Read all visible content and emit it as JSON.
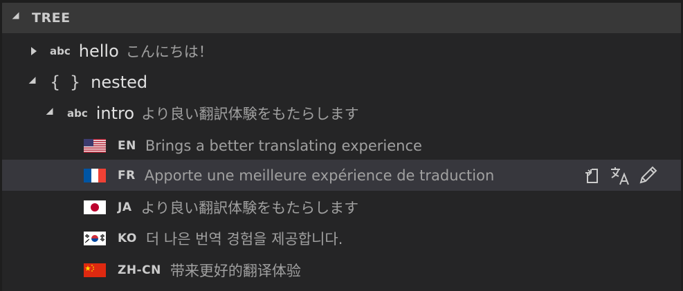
{
  "section": {
    "title": "TREE"
  },
  "rows": [
    {
      "kind": "abc",
      "key": "hello",
      "desc": "こんにちは！"
    },
    {
      "kind": "{ }",
      "key": "nested"
    },
    {
      "kind": "abc",
      "key": "intro",
      "desc": "より良い翻訳体験をもたらします"
    }
  ],
  "translations": [
    {
      "code": "EN",
      "flag": "us-flag-icon",
      "text": "Brings a better translating experience"
    },
    {
      "code": "FR",
      "flag": "france-flag-icon",
      "text": "Apporte une meilleure expérience de traduction"
    },
    {
      "code": "JA",
      "flag": "japan-flag-icon",
      "text": "より良い翻訳体験をもたらします"
    },
    {
      "code": "KO",
      "flag": "korea-flag-icon",
      "text": "더 나은 번역 경험을 제공합니다."
    },
    {
      "code": "ZH-CN",
      "flag": "china-flag-icon",
      "text": "带来更好的翻译体验"
    }
  ],
  "colors": {
    "background": "#252526",
    "header": "#383838",
    "selected": "#37373d"
  }
}
